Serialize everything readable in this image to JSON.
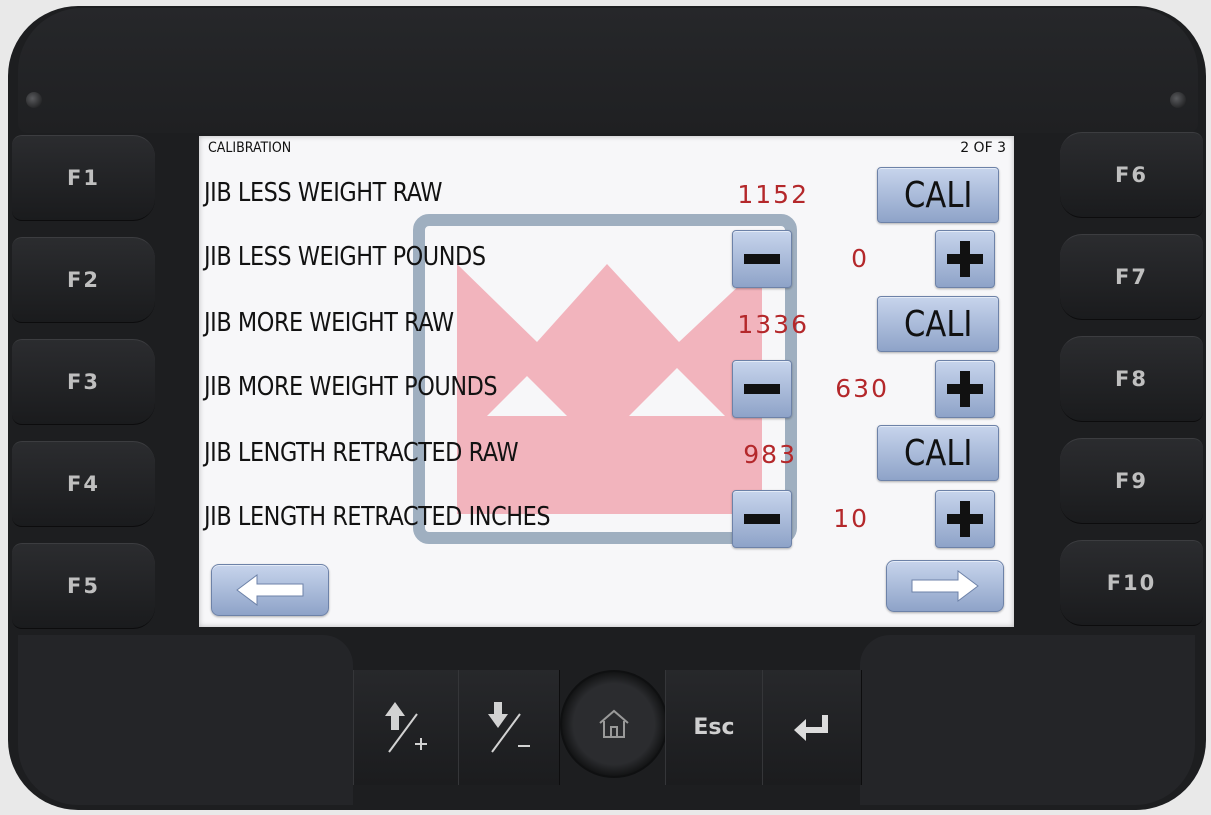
{
  "screen": {
    "title": "CALIBRATION",
    "page_indicator": "2 OF 3",
    "rows": [
      {
        "label": "JIB LESS WEIGHT RAW",
        "value": "1152",
        "control": "cali"
      },
      {
        "label": "JIB LESS WEIGHT POUNDS",
        "value": "0",
        "control": "stepper"
      },
      {
        "label": "JIB MORE WEIGHT RAW",
        "value": "1336",
        "control": "cali"
      },
      {
        "label": "JIB MORE WEIGHT POUNDS",
        "value": "630",
        "control": "stepper"
      },
      {
        "label": "JIB LENGTH RETRACTED RAW",
        "value": "983",
        "control": "cali"
      },
      {
        "label": "JIB LENGTH RETRACTED INCHES",
        "value": "10",
        "control": "stepper"
      }
    ],
    "cali_label": "CALI",
    "nav": {
      "back_icon": "arrow-left-icon",
      "next_icon": "arrow-right-icon"
    }
  },
  "function_keys": {
    "left": [
      "F1",
      "F2",
      "F3",
      "F4",
      "F5"
    ],
    "right": [
      "F6",
      "F7",
      "F8",
      "F9",
      "F10"
    ]
  },
  "bottom_keys": {
    "esc_label": "Esc",
    "icons": [
      "arrow-up-plus-icon",
      "arrow-down-minus-icon",
      "home-icon",
      "esc",
      "enter-icon"
    ]
  },
  "colors": {
    "value_text": "#b4282b",
    "button_face": "#a9b9d9",
    "bezel": "#1d1e20",
    "watermark_crown": "#f2b4bd",
    "watermark_frame": "#8fa2b6"
  }
}
